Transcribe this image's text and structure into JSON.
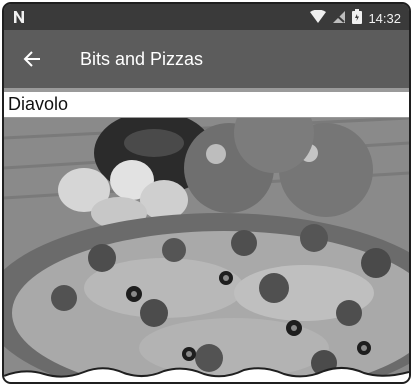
{
  "status_bar": {
    "notification_icon": "n-notification-icon",
    "wifi_icon": "wifi-icon",
    "signal_icon": "signal-off-icon",
    "battery_icon": "battery-icon",
    "time": "14:32"
  },
  "app_bar": {
    "back_icon": "arrow-left-icon",
    "title": "Bits and Pizzas"
  },
  "detail": {
    "pizza_name": "Diavolo",
    "image_subject": "pizza-photo"
  },
  "colors": {
    "status_bar": "#3a3a3a",
    "app_bar": "#5c5c5c",
    "name_bar": "#ffffff"
  }
}
